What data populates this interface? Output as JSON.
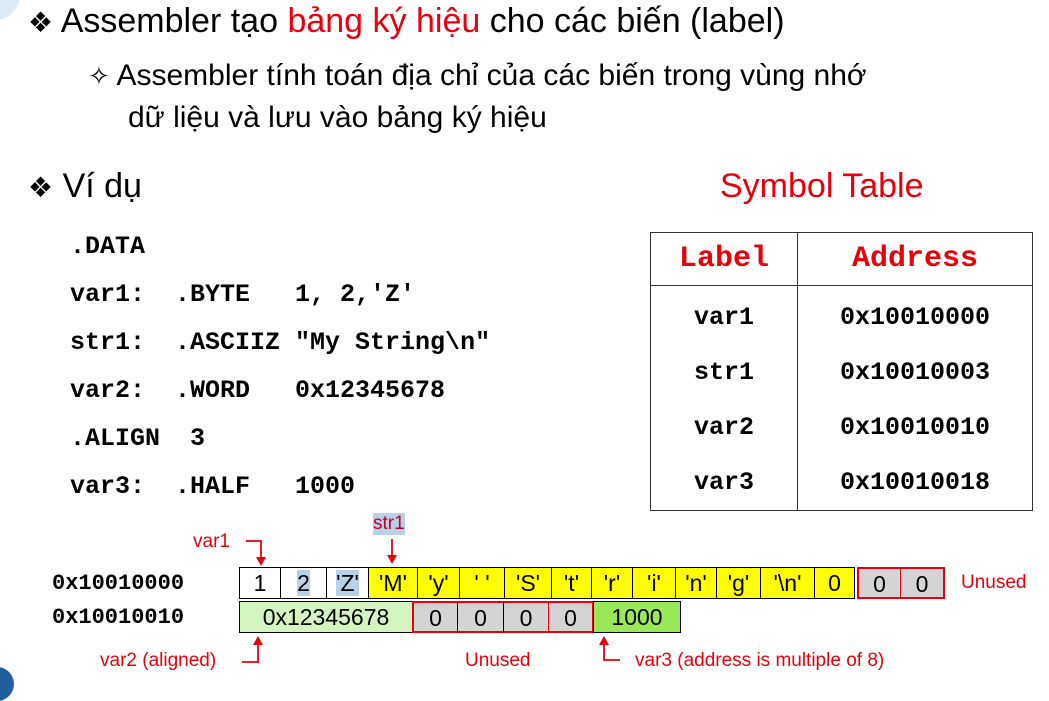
{
  "bullets": {
    "b1_pre": "Assembler tạo ",
    "b1_red": "bảng ký hiệu",
    "b1_post": " cho các biến (label)",
    "b2_line1": "Assembler tính toán địa chỉ của các biến trong vùng nhớ",
    "b2_line2": "dữ liệu và lưu vào bảng ký hiệu",
    "b3": "Ví dụ",
    "diamond": "❖",
    "star": "✧"
  },
  "code": [
    ".DATA",
    "var1:  .BYTE   1, 2,'Z'",
    "str1:  .ASCIIZ \"My String\\n\"",
    "var2:  .WORD   0x12345678",
    ".ALIGN  3",
    "var3:  .HALF   1000"
  ],
  "symbol_table": {
    "title": "Symbol Table",
    "headers": [
      "Label",
      "Address"
    ],
    "labels": [
      "var1",
      "str1",
      "var2",
      "var3"
    ],
    "addresses": [
      "0x10010000",
      "0x10010003",
      "0x10010010",
      "0x10010018"
    ]
  },
  "memory": {
    "row1_addr": "0x10010000",
    "row2_addr": "0x10010010",
    "row1": [
      "1",
      "2",
      "'Z'",
      "'M'",
      "'y'",
      "' '",
      "'S'",
      "'t'",
      "'r'",
      "'i'",
      "'n'",
      "'g'",
      "'\\n'",
      "0",
      "0",
      "0"
    ],
    "row2": [
      "0x12345678",
      "0",
      "0",
      "0",
      "0",
      "1000"
    ],
    "labels": {
      "var1": "var1",
      "str1": "str1",
      "unused_right": "Unused",
      "var2": "var2 (aligned)",
      "unused_bottom": "Unused",
      "var3": "var3 (address is multiple of 8)"
    }
  },
  "colors": {
    "red": "#e8000b",
    "yellow": "#ffff00",
    "green": "#98e85a",
    "light_green": "#d5f5c0",
    "gray": "#d4d4d4"
  }
}
